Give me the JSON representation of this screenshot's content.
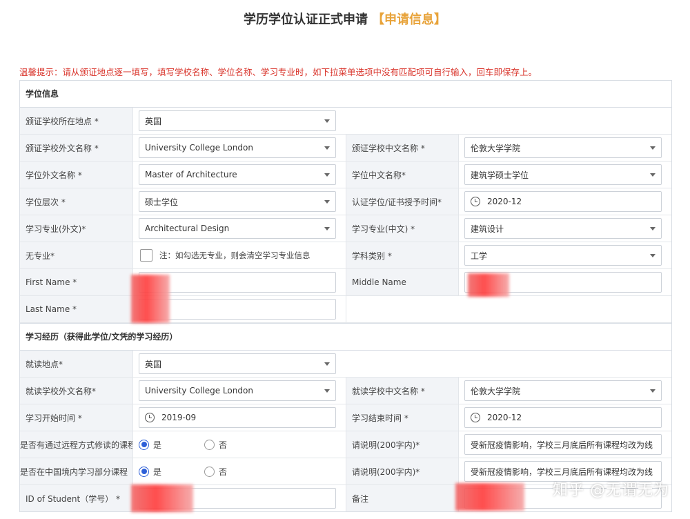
{
  "page": {
    "title": "学历学位认证正式申请",
    "title_highlight": "【申请信息】",
    "tip": "温馨提示：请从颁证地点逐一填写，填写学校名称、学位名称、学习专业时，如下拉菜单选项中没有匹配项可自行输入，回车即保存上。"
  },
  "colors": {
    "title_highlight": "#e8a33a",
    "tip": "#d9342b",
    "radio": "#2d5fd8"
  },
  "section1": {
    "title": "学位信息",
    "school_location": {
      "label": "颁证学校所在地点 *",
      "value": "英国"
    },
    "school_foreign_name": {
      "label": "颁证学校外文名称 *",
      "value": "University College London"
    },
    "school_chinese_name": {
      "label": "颁证学校中文名称 *",
      "value": "伦敦大学学院"
    },
    "degree_foreign_name": {
      "label": "学位外文名称 *",
      "value": "Master of Architecture"
    },
    "degree_chinese_name": {
      "label": "学位中文名称*",
      "value": "建筑学硕士学位"
    },
    "degree_level": {
      "label": "学位层次 *",
      "value": "硕士学位"
    },
    "cert_time": {
      "label": "认证学位/证书授予时间*",
      "value": "2020-12"
    },
    "major_foreign": {
      "label": "学习专业(外文)*",
      "value": "Architectural Design"
    },
    "major_chinese": {
      "label": "学习专业(中文) *",
      "value": "建筑设计"
    },
    "no_major": {
      "label": "无专业*",
      "note": "注：如勾选无专业，则会清空学习专业信息"
    },
    "discipline": {
      "label": "学科类别 *",
      "value": "工学"
    },
    "first_name": {
      "label": "First Name *",
      "value": ""
    },
    "middle_name": {
      "label": "Middle Name",
      "value": ""
    },
    "last_name": {
      "label": "Last Name *",
      "value": ""
    }
  },
  "section2": {
    "title": "学习经历（获得此学位/文凭的学习经历）",
    "study_location": {
      "label": "就读地点*",
      "value": "英国"
    },
    "study_school_foreign": {
      "label": "就读学校外文名称*",
      "value": "University College London"
    },
    "study_school_chinese": {
      "label": "就读学校中文名称 *",
      "value": "伦敦大学学院"
    },
    "start_time": {
      "label": "学习开始时间 *",
      "value": "2019-09"
    },
    "end_time": {
      "label": "学习结束时间 *",
      "value": "2020-12"
    },
    "remote": {
      "label": "是否有通过远程方式修读的课程",
      "yes": "是",
      "no": "否",
      "explain_label": "请说明(200字内)*",
      "explain_value": "受新冠疫情影响，学校三月底后所有课程均改为线"
    },
    "china": {
      "label": "是否在中国境内学习部分课程",
      "yes": "是",
      "no": "否",
      "explain_label": "请说明(200字内)*",
      "explain_value": "受新冠疫情影响，学校三月底后所有课程均改为线"
    },
    "student_id": {
      "label": "ID of Student（学号） *",
      "value": ""
    },
    "remark": {
      "label": "备注",
      "value": ""
    }
  },
  "watermark": "知乎 @无谓无为"
}
